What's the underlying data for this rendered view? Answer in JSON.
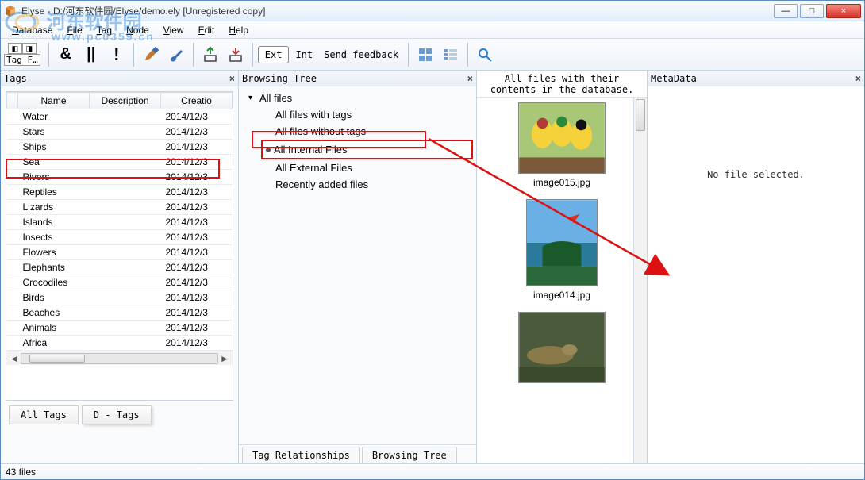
{
  "window": {
    "title": "Elyse - D:/河东软件园/Elyse/demo.ely [Unregistered copy]",
    "min": "—",
    "max": "□",
    "close": "×"
  },
  "watermark": {
    "text": "河东软件园",
    "url": "www.pc0359.cn"
  },
  "menu": {
    "database": "Database",
    "file": "File",
    "tag": "Tag",
    "node": "Node",
    "view": "View",
    "edit": "Edit",
    "help": "Help"
  },
  "toolbar": {
    "tagf": "Tag F…",
    "amp": "&",
    "pipe": "||",
    "not": "!",
    "ext": "Ext",
    "int": "Int",
    "feedback": "Send feedback"
  },
  "tags_panel": {
    "title": "Tags",
    "columns": {
      "name": "Name",
      "desc": "Description",
      "creation": "Creatio"
    },
    "rows": [
      {
        "name": "Water",
        "date": "2014/12/3"
      },
      {
        "name": "Stars",
        "date": "2014/12/3"
      },
      {
        "name": "Ships",
        "date": "2014/12/3"
      },
      {
        "name": "Sea",
        "date": "2014/12/3"
      },
      {
        "name": "Rivers",
        "date": "2014/12/3"
      },
      {
        "name": "Reptiles",
        "date": "2014/12/3"
      },
      {
        "name": "Lizards",
        "date": "2014/12/3"
      },
      {
        "name": "Islands",
        "date": "2014/12/3"
      },
      {
        "name": "Insects",
        "date": "2014/12/3"
      },
      {
        "name": "Flowers",
        "date": "2014/12/3"
      },
      {
        "name": "Elephants",
        "date": "2014/12/3"
      },
      {
        "name": "Crocodiles",
        "date": "2014/12/3"
      },
      {
        "name": "Birds",
        "date": "2014/12/3"
      },
      {
        "name": "Beaches",
        "date": "2014/12/3"
      },
      {
        "name": "Animals",
        "date": "2014/12/3"
      },
      {
        "name": "Africa",
        "date": "2014/12/3"
      }
    ],
    "tab_all": "All Tags",
    "tab_d": "D - Tags"
  },
  "tree_panel": {
    "title": "Browsing Tree",
    "root": "All files",
    "items": [
      "All files with tags",
      "All files without tags",
      "All Internal Files",
      "All External Files",
      "Recently added files"
    ],
    "bottom_tabs": {
      "rel": "Tag Relationships",
      "browse": "Browsing Tree"
    }
  },
  "thumbs": {
    "breadcrumb": "All files with their contents in the database.",
    "items": [
      {
        "label": "image015.jpg"
      },
      {
        "label": "image014.jpg"
      },
      {
        "label": ""
      }
    ]
  },
  "meta": {
    "title": "MetaData",
    "empty": "No file selected."
  },
  "status": {
    "text": "43 files"
  }
}
